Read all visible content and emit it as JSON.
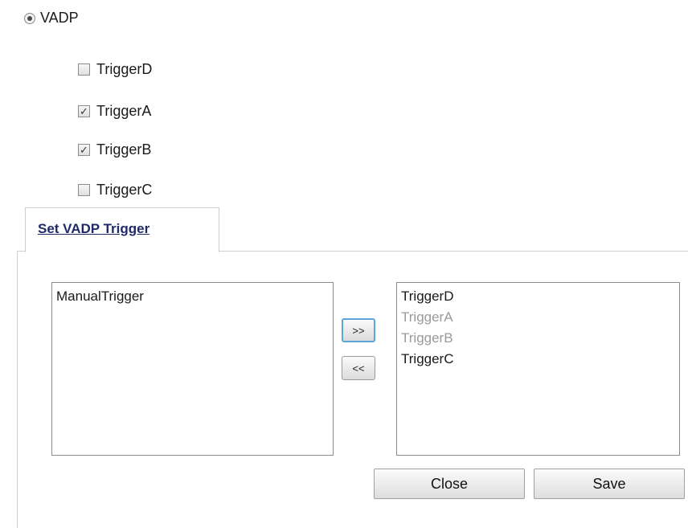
{
  "mode": {
    "label": "VADP",
    "selected": true
  },
  "triggers": [
    {
      "label": "TriggerD",
      "checked": false
    },
    {
      "label": "TriggerA",
      "checked": true
    },
    {
      "label": "TriggerB",
      "checked": true
    },
    {
      "label": "TriggerC",
      "checked": false
    }
  ],
  "tab": {
    "label": "Set VADP Trigger"
  },
  "available_list": {
    "items": [
      "ManualTrigger"
    ]
  },
  "selected_list": {
    "items": [
      {
        "label": "TriggerD",
        "disabled": false
      },
      {
        "label": "TriggerA",
        "disabled": true
      },
      {
        "label": "TriggerB",
        "disabled": true
      },
      {
        "label": "TriggerC",
        "disabled": false
      }
    ]
  },
  "buttons": {
    "add": ">>",
    "remove": "<<",
    "close": "Close",
    "save": "Save"
  },
  "icons": {
    "check": "✓"
  }
}
